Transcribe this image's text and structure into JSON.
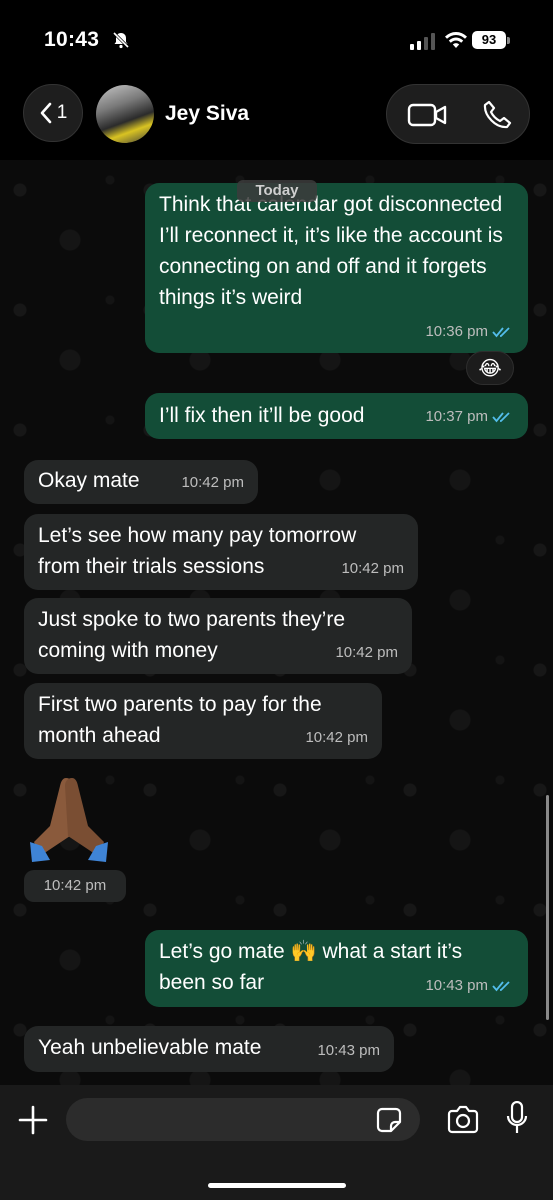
{
  "status_bar": {
    "time": "10:43",
    "battery": "93"
  },
  "header": {
    "back_count": "1",
    "contact_name": "Jey Siva"
  },
  "date_chip": "Today",
  "messages": [
    {
      "direction": "out",
      "text": "Think that calendar got disconnected I’ll reconnect it, it’s like the account is connecting on and off and it forgets things  it’s weird",
      "time": "10:36 pm",
      "reaction": "😂"
    },
    {
      "direction": "out",
      "text": "I’ll fix then it’ll be good",
      "time": "10:37 pm"
    },
    {
      "direction": "in",
      "text": "Okay mate",
      "time": "10:42 pm"
    },
    {
      "direction": "in",
      "text": "Let’s see how many pay tomorrow from their trials sessions",
      "time": "10:42 pm"
    },
    {
      "direction": "in",
      "text": "Just spoke to two parents they’re coming with money",
      "time": "10:42 pm"
    },
    {
      "direction": "in",
      "text": "First two parents to pay for the month ahead",
      "time": "10:42 pm"
    },
    {
      "direction": "in",
      "emoji": "🙏🏾",
      "time": "10:42 pm"
    },
    {
      "direction": "out",
      "text": "Let’s go mate 🙌 what a start it’s been so far",
      "time": "10:43 pm"
    },
    {
      "direction": "in",
      "text": "Yeah unbelievable mate",
      "time": "10:43 pm"
    }
  ],
  "input": {
    "placeholder": "",
    "value": ""
  },
  "colors": {
    "outgoing": "#134d37",
    "incoming": "#242626",
    "read_ticks": "#53bdeb"
  }
}
